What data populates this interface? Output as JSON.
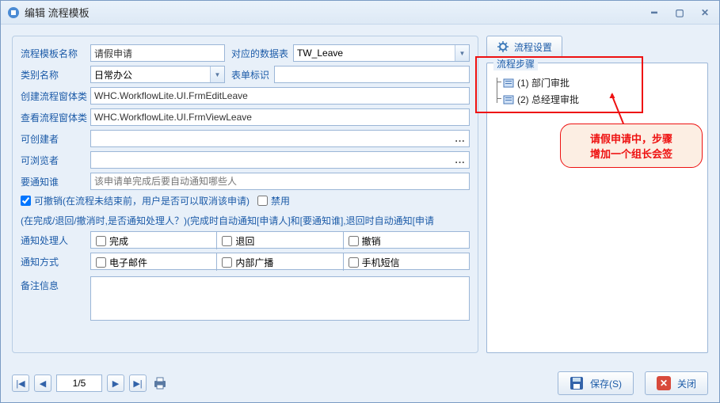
{
  "window": {
    "title": "编辑  流程模板"
  },
  "labels": {
    "flow_template_name": "流程模板名称",
    "data_table": "对应的数据表",
    "category_name": "类别名称",
    "form_id": "表单标识",
    "create_window_class": "创建流程窗体类",
    "view_window_class": "查看流程窗体类",
    "can_create": "可创建者",
    "can_view": "可浏览者",
    "notify_who": "要通知谁",
    "revocable": "可撤销(在流程未结束前，用户是否可以取消该申请)",
    "disabled": "禁用",
    "section_note": "(在完成/退回/撤消时,是否通知处理人？)(完成时自动通知[申请人]和[要通知谁],退回时自动通知[申请",
    "notify_handler": "通知处理人",
    "notify_method": "通知方式",
    "remark": "备注信息"
  },
  "values": {
    "flow_template_name": "请假申请",
    "data_table": "TW_Leave",
    "category_name": "日常办公",
    "form_id": "",
    "create_window_class": "WHC.WorkflowLite.UI.FrmEditLeave",
    "view_window_class": "WHC.WorkflowLite.UI.FrmViewLeave",
    "notify_who_placeholder": "该申请单完成后要自动通知哪些人",
    "revocable_checked": true,
    "disabled_checked": false
  },
  "handler_options": {
    "complete": "完成",
    "return": "退回",
    "revoke": "撤销"
  },
  "method_options": {
    "email": "电子邮件",
    "broadcast": "内部广播",
    "sms": "手机短信"
  },
  "right": {
    "config_button": "流程设置",
    "group_title": "流程步骤",
    "steps": [
      {
        "label": "(1) 部门审批"
      },
      {
        "label": "(2) 总经理审批"
      }
    ],
    "callout_line1": "请假申请中，步骤",
    "callout_line2": "增加一个组长会签"
  },
  "pager": {
    "page_display": "1/5"
  },
  "footer": {
    "save": "保存(S)",
    "close": "关闭"
  }
}
